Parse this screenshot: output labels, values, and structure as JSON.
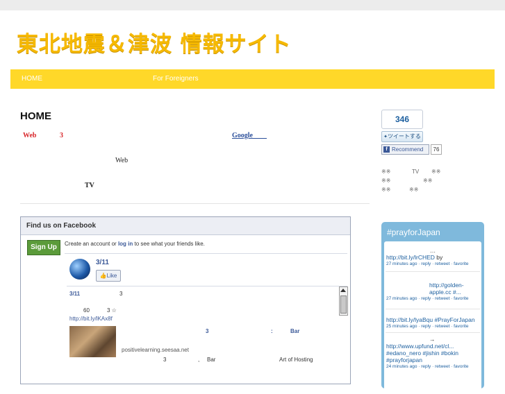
{
  "site": {
    "title": "東北地震＆津波 情報サイト"
  },
  "nav": {
    "home": "HOME",
    "foreigners": "For Foreigners"
  },
  "main": {
    "page_title": "HOME",
    "web": "Web",
    "three": "3",
    "google": "Google",
    "web2": "Web",
    "tv": "TV"
  },
  "facebook": {
    "header": "Find us on Facebook",
    "signup": "Sign Up",
    "create_pre": "Create an account or ",
    "login": "log in",
    "create_post": " to see what your friends like.",
    "page_name": "3/11",
    "like": "Like",
    "post_name": "3/11",
    "post_three": "3",
    "post_sixty": "60",
    "post_three_star": "3 ☆",
    "post_link": "http://bit.ly/lKAx8f",
    "story_three": "3",
    "story_colon": ":",
    "story_bar": "Bar",
    "story_domain": "positivelearning.seesaa.net",
    "story_three2": "3",
    "story_comma": ",",
    "story_bar2": "Bar",
    "story_art": "Art of Hosting"
  },
  "sidebar": {
    "count": "346",
    "tweet_btn": "ツイートする",
    "recommend": "Recommend",
    "recommend_count": "76",
    "line1_a": "※※",
    "line1_b": "TV",
    "line1_c": "※※",
    "line2_a": "※※",
    "line2_b": "※※",
    "line3_a": "※※",
    "line3_b": "※※"
  },
  "twitter": {
    "title": "#prayforJapan",
    "tweets": [
      {
        "pre": "…",
        "link": "http://bit.ly/lrCHED",
        "tail": " by",
        "meta": "27 minutes ago · reply · retweet · favorite"
      },
      {
        "link": "http://golden-apple.cc #...",
        "meta": "27 minutes ago · reply · retweet · favorite"
      },
      {
        "link": "http://bit.ly/lyaBqu #PrayForJapan",
        "meta": "25 minutes ago · reply · retweet · favorite"
      },
      {
        "pre": "→",
        "link": "http://www.upfund.net/cl... #edano_nero #jishin #bokin #prayforjapan",
        "meta": "24 minutes ago · reply · retweet · favorite"
      }
    ]
  },
  "colors": {
    "nav_bg": "#ffd829",
    "title": "#f6b900",
    "fb_blue": "#3b5998",
    "twitter_bg": "#7fb9dc"
  }
}
